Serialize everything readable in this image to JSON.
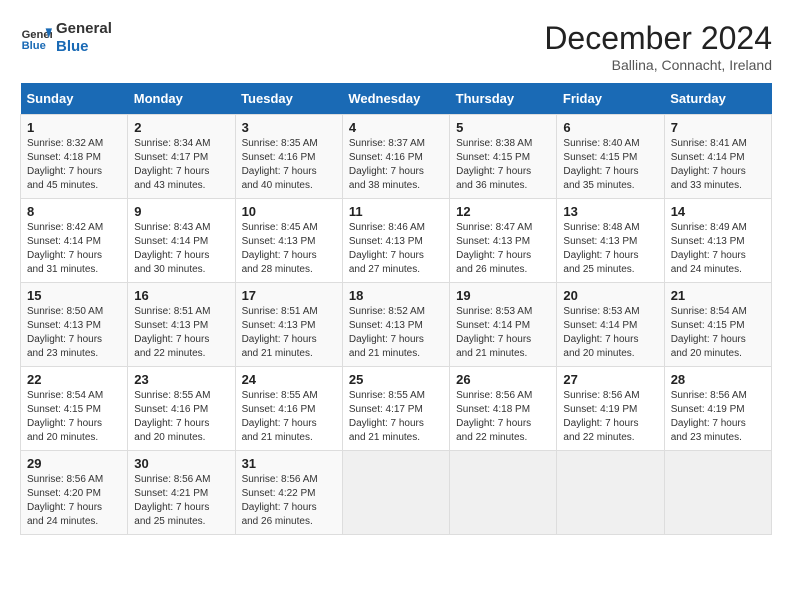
{
  "logo": {
    "line1": "General",
    "line2": "Blue"
  },
  "title": "December 2024",
  "location": "Ballina, Connacht, Ireland",
  "days_of_week": [
    "Sunday",
    "Monday",
    "Tuesday",
    "Wednesday",
    "Thursday",
    "Friday",
    "Saturday"
  ],
  "weeks": [
    [
      {
        "day": "1",
        "sunrise": "8:32 AM",
        "sunset": "4:18 PM",
        "daylight": "7 hours and 45 minutes."
      },
      {
        "day": "2",
        "sunrise": "8:34 AM",
        "sunset": "4:17 PM",
        "daylight": "7 hours and 43 minutes."
      },
      {
        "day": "3",
        "sunrise": "8:35 AM",
        "sunset": "4:16 PM",
        "daylight": "7 hours and 40 minutes."
      },
      {
        "day": "4",
        "sunrise": "8:37 AM",
        "sunset": "4:16 PM",
        "daylight": "7 hours and 38 minutes."
      },
      {
        "day": "5",
        "sunrise": "8:38 AM",
        "sunset": "4:15 PM",
        "daylight": "7 hours and 36 minutes."
      },
      {
        "day": "6",
        "sunrise": "8:40 AM",
        "sunset": "4:15 PM",
        "daylight": "7 hours and 35 minutes."
      },
      {
        "day": "7",
        "sunrise": "8:41 AM",
        "sunset": "4:14 PM",
        "daylight": "7 hours and 33 minutes."
      }
    ],
    [
      {
        "day": "8",
        "sunrise": "8:42 AM",
        "sunset": "4:14 PM",
        "daylight": "7 hours and 31 minutes."
      },
      {
        "day": "9",
        "sunrise": "8:43 AM",
        "sunset": "4:14 PM",
        "daylight": "7 hours and 30 minutes."
      },
      {
        "day": "10",
        "sunrise": "8:45 AM",
        "sunset": "4:13 PM",
        "daylight": "7 hours and 28 minutes."
      },
      {
        "day": "11",
        "sunrise": "8:46 AM",
        "sunset": "4:13 PM",
        "daylight": "7 hours and 27 minutes."
      },
      {
        "day": "12",
        "sunrise": "8:47 AM",
        "sunset": "4:13 PM",
        "daylight": "7 hours and 26 minutes."
      },
      {
        "day": "13",
        "sunrise": "8:48 AM",
        "sunset": "4:13 PM",
        "daylight": "7 hours and 25 minutes."
      },
      {
        "day": "14",
        "sunrise": "8:49 AM",
        "sunset": "4:13 PM",
        "daylight": "7 hours and 24 minutes."
      }
    ],
    [
      {
        "day": "15",
        "sunrise": "8:50 AM",
        "sunset": "4:13 PM",
        "daylight": "7 hours and 23 minutes."
      },
      {
        "day": "16",
        "sunrise": "8:51 AM",
        "sunset": "4:13 PM",
        "daylight": "7 hours and 22 minutes."
      },
      {
        "day": "17",
        "sunrise": "8:51 AM",
        "sunset": "4:13 PM",
        "daylight": "7 hours and 21 minutes."
      },
      {
        "day": "18",
        "sunrise": "8:52 AM",
        "sunset": "4:13 PM",
        "daylight": "7 hours and 21 minutes."
      },
      {
        "day": "19",
        "sunrise": "8:53 AM",
        "sunset": "4:14 PM",
        "daylight": "7 hours and 21 minutes."
      },
      {
        "day": "20",
        "sunrise": "8:53 AM",
        "sunset": "4:14 PM",
        "daylight": "7 hours and 20 minutes."
      },
      {
        "day": "21",
        "sunrise": "8:54 AM",
        "sunset": "4:15 PM",
        "daylight": "7 hours and 20 minutes."
      }
    ],
    [
      {
        "day": "22",
        "sunrise": "8:54 AM",
        "sunset": "4:15 PM",
        "daylight": "7 hours and 20 minutes."
      },
      {
        "day": "23",
        "sunrise": "8:55 AM",
        "sunset": "4:16 PM",
        "daylight": "7 hours and 20 minutes."
      },
      {
        "day": "24",
        "sunrise": "8:55 AM",
        "sunset": "4:16 PM",
        "daylight": "7 hours and 21 minutes."
      },
      {
        "day": "25",
        "sunrise": "8:55 AM",
        "sunset": "4:17 PM",
        "daylight": "7 hours and 21 minutes."
      },
      {
        "day": "26",
        "sunrise": "8:56 AM",
        "sunset": "4:18 PM",
        "daylight": "7 hours and 22 minutes."
      },
      {
        "day": "27",
        "sunrise": "8:56 AM",
        "sunset": "4:19 PM",
        "daylight": "7 hours and 22 minutes."
      },
      {
        "day": "28",
        "sunrise": "8:56 AM",
        "sunset": "4:19 PM",
        "daylight": "7 hours and 23 minutes."
      }
    ],
    [
      {
        "day": "29",
        "sunrise": "8:56 AM",
        "sunset": "4:20 PM",
        "daylight": "7 hours and 24 minutes."
      },
      {
        "day": "30",
        "sunrise": "8:56 AM",
        "sunset": "4:21 PM",
        "daylight": "7 hours and 25 minutes."
      },
      {
        "day": "31",
        "sunrise": "8:56 AM",
        "sunset": "4:22 PM",
        "daylight": "7 hours and 26 minutes."
      },
      null,
      null,
      null,
      null
    ]
  ],
  "labels": {
    "sunrise": "Sunrise:",
    "sunset": "Sunset:",
    "daylight": "Daylight:"
  }
}
